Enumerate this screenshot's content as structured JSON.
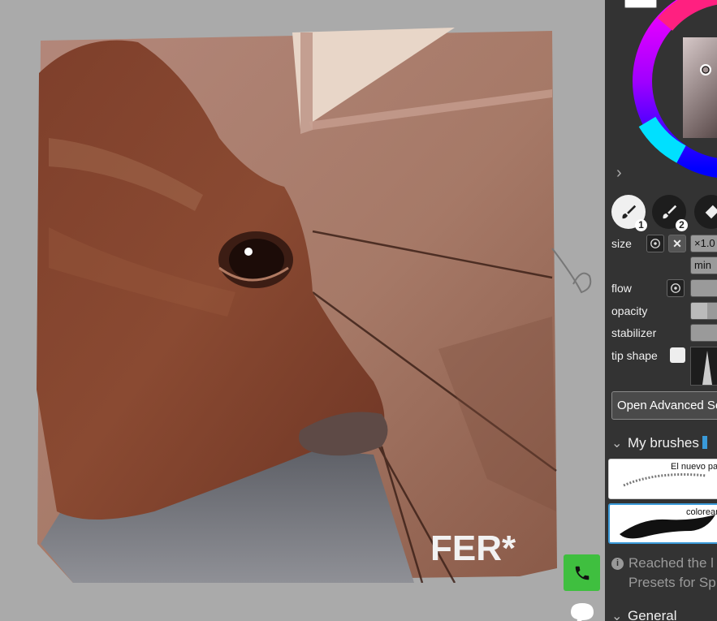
{
  "artwork": {
    "signature": "FER*"
  },
  "brush_panel": {
    "tools": [
      {
        "name": "brush-tool-1",
        "number": "1"
      },
      {
        "name": "brush-tool-2",
        "number": "2"
      },
      {
        "name": "eraser-tool"
      }
    ],
    "size": {
      "label": "size",
      "value": "×1.0",
      "min_label": "min"
    },
    "flow": {
      "label": "flow"
    },
    "opacity": {
      "label": "opacity"
    },
    "stabilizer": {
      "label": "stabilizer"
    },
    "tip_shape": {
      "label": "tip shape"
    },
    "open_advanced_label": "Open Advanced Se",
    "my_brushes": {
      "title": "My brushes",
      "brushes": [
        {
          "name": "El nuevo pa"
        },
        {
          "name": "colorear"
        }
      ]
    },
    "info_line1": "Reached the l",
    "info_line2": "Presets for Sp",
    "general_label": "General"
  },
  "colors": {
    "panel_bg": "#333333",
    "canvas_bg": "#aaaaaa",
    "call_button": "#3fbf3f",
    "selected_brush_border": "#3a9ad9"
  }
}
